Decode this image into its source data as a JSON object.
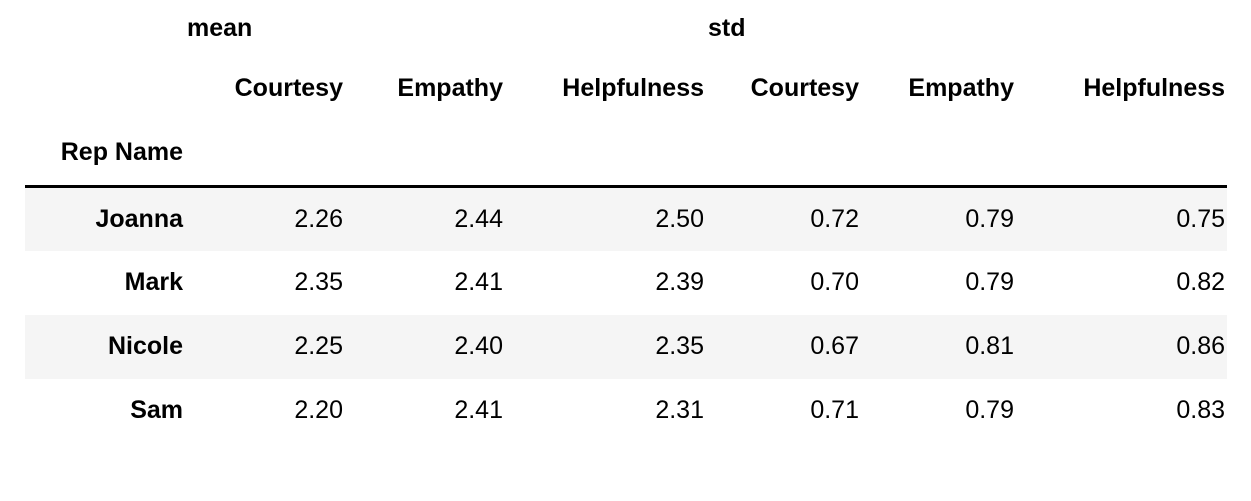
{
  "table": {
    "index_name": "Rep Name",
    "column_groups": [
      {
        "label": "mean",
        "spans": 3
      },
      {
        "label": "std",
        "spans": 3
      }
    ],
    "sub_columns": [
      "Courtesy",
      "Empathy",
      "Helpfulness",
      "Courtesy",
      "Empathy",
      "Helpfulness"
    ],
    "rows": [
      {
        "name": "Joanna",
        "values": [
          "2.26",
          "2.44",
          "2.50",
          "0.72",
          "0.79",
          "0.75"
        ]
      },
      {
        "name": "Mark",
        "values": [
          "2.35",
          "2.41",
          "2.39",
          "0.70",
          "0.79",
          "0.82"
        ]
      },
      {
        "name": "Nicole",
        "values": [
          "2.25",
          "2.40",
          "2.35",
          "0.67",
          "0.81",
          "0.86"
        ]
      },
      {
        "name": "Sam",
        "values": [
          "2.20",
          "2.41",
          "2.31",
          "0.71",
          "0.79",
          "0.83"
        ]
      }
    ]
  },
  "chart_data": {
    "type": "table",
    "title": "",
    "index_label": "Rep Name",
    "categories": [
      "Joanna",
      "Mark",
      "Nicole",
      "Sam"
    ],
    "columns": [
      "mean Courtesy",
      "mean Empathy",
      "mean Helpfulness",
      "std Courtesy",
      "std Empathy",
      "std Helpfulness"
    ],
    "series": [
      {
        "name": "mean Courtesy",
        "values": [
          2.26,
          2.35,
          2.25,
          2.2
        ]
      },
      {
        "name": "mean Empathy",
        "values": [
          2.44,
          2.41,
          2.4,
          2.41
        ]
      },
      {
        "name": "mean Helpfulness",
        "values": [
          2.5,
          2.39,
          2.35,
          2.31
        ]
      },
      {
        "name": "std Courtesy",
        "values": [
          0.72,
          0.7,
          0.67,
          0.71
        ]
      },
      {
        "name": "std Empathy",
        "values": [
          0.79,
          0.79,
          0.81,
          0.79
        ]
      },
      {
        "name": "std Helpfulness",
        "values": [
          0.75,
          0.82,
          0.86,
          0.83
        ]
      }
    ],
    "xlabel": "Rep Name",
    "ylabel": "",
    "grid": false,
    "legend": "none"
  },
  "style": {
    "stripe_color": "#f5f5f5",
    "rule_color": "#000000",
    "background": "#ffffff",
    "text_color": "#000000"
  }
}
